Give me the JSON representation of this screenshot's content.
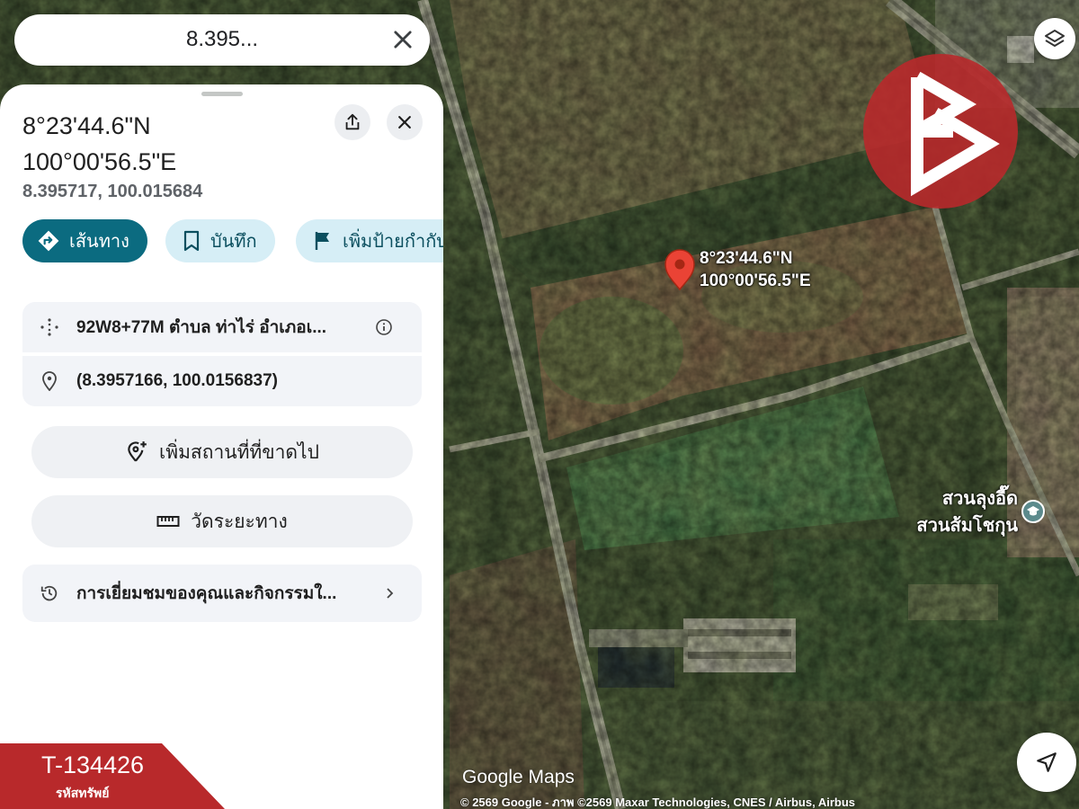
{
  "search": {
    "query": "8.395..."
  },
  "place": {
    "title_line1": "8°23'44.6\"N",
    "title_line2": "100°00'56.5\"E",
    "decimal": "8.395717, 100.015684"
  },
  "actions": {
    "directions": "เส้นทาง",
    "save": "บันทึก",
    "label": "เพิ่มป้ายกำกับ"
  },
  "details": {
    "plus_code": "92W8+77M ตำบล ท่าไร่ อำเภอเ...",
    "coordinates": "(8.3957166, 100.0156837)",
    "add_missing_place": "เพิ่มสถานที่ที่ขาดไป",
    "measure_distance": "วัดระยะทาง",
    "activity": "การเยี่ยมชมของคุณและกิจกรรมใ..."
  },
  "map": {
    "pin_label_line1": "8°23'44.6\"N",
    "pin_label_line2": "100°00'56.5\"E",
    "poi_line1": "สวนลุงอี๊ด",
    "poi_line2": "สวนส้มโชกุน",
    "logo": "Google Maps",
    "attribution": "© 2569 Google - ภาพ ©2569 Maxar Technologies, CNES / Airbus, Airbus"
  },
  "asset": {
    "code": "T-134426",
    "label": "รหัสทรัพย์"
  },
  "icons": {
    "close": "close-icon",
    "share": "share-icon",
    "directions": "directions-icon",
    "bookmark": "bookmark-icon",
    "flag": "flag-icon",
    "plus_code": "plus-code-icon",
    "info": "info-icon",
    "location_pin": "location-pin-icon",
    "add_place": "add-location-icon",
    "ruler": "ruler-icon",
    "history": "history-icon",
    "chevron": "chevron-right-icon",
    "layers": "layers-icon",
    "navigate": "navigation-arrow-icon"
  },
  "colors": {
    "primary_chip": "#0b6b80",
    "secondary_chip": "#d6eef6",
    "pin": "#ea4335",
    "brand": "#b8292b"
  }
}
